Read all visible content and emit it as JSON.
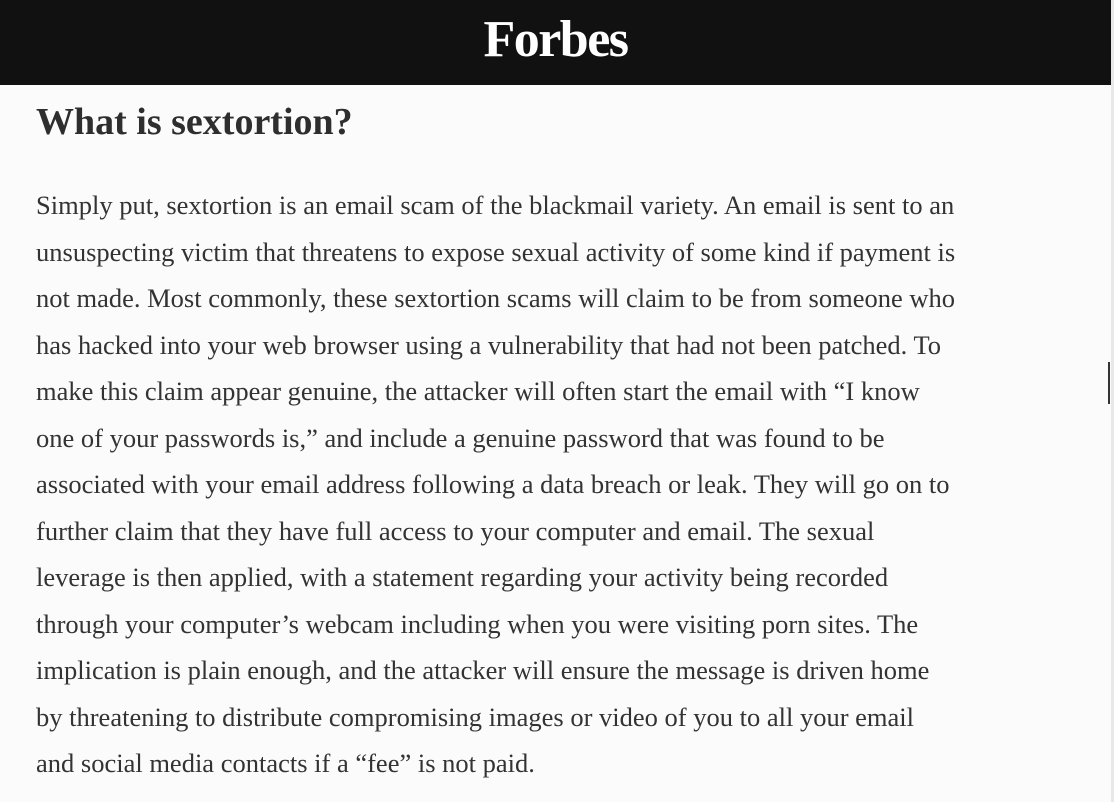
{
  "header": {
    "logo_text": "Forbes",
    "background_color": "#111111",
    "logo_color": "#ffffff"
  },
  "article": {
    "title": "What is sextortion?",
    "lines": [
      "Simply put, sextortion is an email scam of the blackmail variety. An email is sent to an",
      "unsuspecting victim that threatens to expose sexual activity of some kind if payment is",
      "not made. Most commonly, these sextortion scams will claim to be from someone who",
      "has hacked into your web browser using a vulnerability that had not been patched. To",
      "make this claim appear genuine, the attacker will often start the email with “I know",
      "one of your passwords is,” and include a genuine password that was found to be",
      "associated with your email address following a data breach or leak. They will go on to",
      "further claim that they have full access to your computer and email. The sexual",
      "leverage is then applied, with a statement regarding your activity being recorded",
      "through your computer’s webcam including when you were visiting porn sites. The",
      "implication is plain enough, and the attacker will ensure the message is driven home",
      "by threatening to distribute compromising images or video of you to all your email",
      "and social media contacts if a “fee” is not paid."
    ]
  }
}
